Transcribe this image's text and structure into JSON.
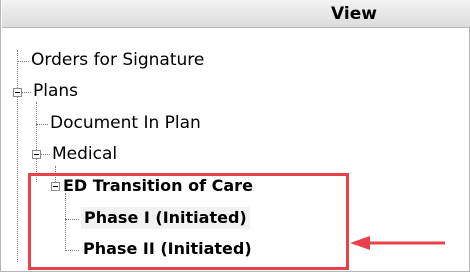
{
  "panel": {
    "header": "View"
  },
  "tree": {
    "orders_for_signature": "Orders for Signature",
    "plans": "Plans",
    "document_in_plan": "Document In Plan",
    "medical": "Medical",
    "ed_transition": "ED Transition of Care",
    "phase_1": "Phase I (Initiated)",
    "phase_2": "Phase II (Initiated)"
  },
  "colors": {
    "highlight": "#e8414a",
    "arrow": "#e8414a"
  }
}
